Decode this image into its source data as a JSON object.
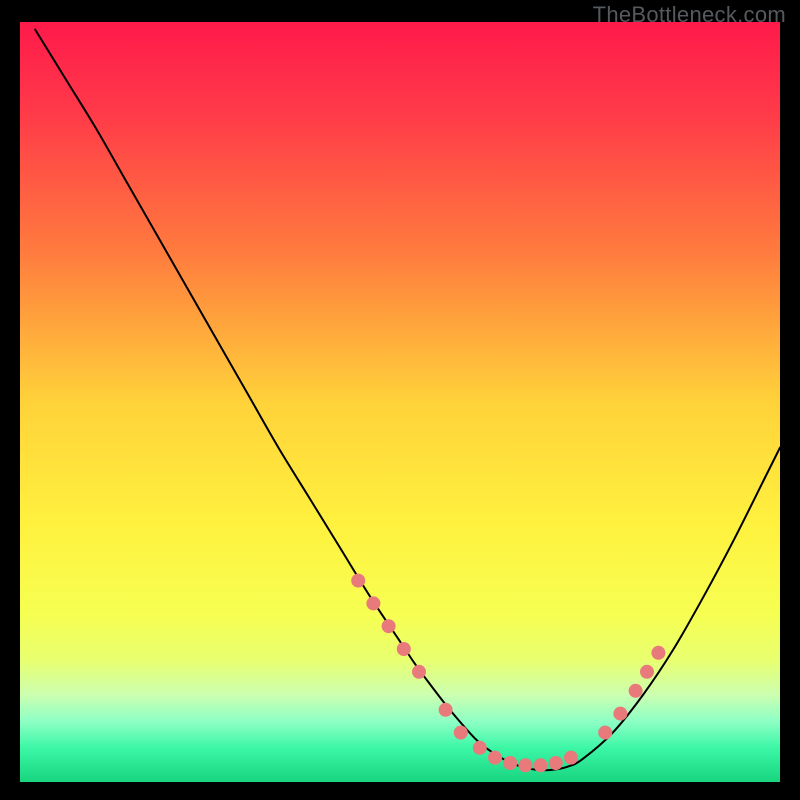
{
  "watermark": "TheBottleneck.com",
  "chart_data": {
    "type": "line",
    "title": "",
    "xlabel": "",
    "ylabel": "",
    "xlim": [
      0,
      100
    ],
    "ylim": [
      0,
      100
    ],
    "gradient_stops": [
      {
        "offset": 0.0,
        "color": "#ff1a4b"
      },
      {
        "offset": 0.12,
        "color": "#ff3a49"
      },
      {
        "offset": 0.3,
        "color": "#ff7a3e"
      },
      {
        "offset": 0.5,
        "color": "#ffd23a"
      },
      {
        "offset": 0.66,
        "color": "#fff13e"
      },
      {
        "offset": 0.78,
        "color": "#f6ff52"
      },
      {
        "offset": 0.84,
        "color": "#e8ff70"
      },
      {
        "offset": 0.885,
        "color": "#ccffb0"
      },
      {
        "offset": 0.92,
        "color": "#8effc5"
      },
      {
        "offset": 0.955,
        "color": "#3cf7a6"
      },
      {
        "offset": 1.0,
        "color": "#18d57f"
      }
    ],
    "series": [
      {
        "name": "bottleneck-curve",
        "color": "#000000",
        "width": 2.0,
        "x": [
          2,
          6,
          10,
          14,
          18,
          22,
          26,
          30,
          34,
          38,
          42,
          46,
          50,
          52,
          54,
          56,
          58,
          60,
          62,
          64,
          66,
          68,
          70,
          72,
          74,
          78,
          82,
          86,
          90,
          94,
          98,
          100
        ],
        "y": [
          99,
          92.5,
          86,
          79,
          72,
          65,
          58,
          51,
          44,
          37.5,
          31,
          24.5,
          18.5,
          15.5,
          12.8,
          10.2,
          7.8,
          5.6,
          4.0,
          2.8,
          2.0,
          1.6,
          1.6,
          2.0,
          3.0,
          6.5,
          11.5,
          17.5,
          24.5,
          32,
          40,
          44
        ]
      }
    ],
    "markers": {
      "color": "#e97a7b",
      "radius": 7,
      "points": [
        {
          "x": 44.5,
          "y": 26.5
        },
        {
          "x": 46.5,
          "y": 23.5
        },
        {
          "x": 48.5,
          "y": 20.5
        },
        {
          "x": 50.5,
          "y": 17.5
        },
        {
          "x": 52.5,
          "y": 14.5
        },
        {
          "x": 56.0,
          "y": 9.5
        },
        {
          "x": 58.0,
          "y": 6.5
        },
        {
          "x": 60.5,
          "y": 4.5
        },
        {
          "x": 62.5,
          "y": 3.2
        },
        {
          "x": 64.5,
          "y": 2.5
        },
        {
          "x": 66.5,
          "y": 2.2
        },
        {
          "x": 68.5,
          "y": 2.2
        },
        {
          "x": 70.5,
          "y": 2.5
        },
        {
          "x": 72.5,
          "y": 3.2
        },
        {
          "x": 77.0,
          "y": 6.5
        },
        {
          "x": 79.0,
          "y": 9.0
        },
        {
          "x": 81.0,
          "y": 12.0
        },
        {
          "x": 82.5,
          "y": 14.5
        },
        {
          "x": 84.0,
          "y": 17.0
        }
      ]
    }
  }
}
